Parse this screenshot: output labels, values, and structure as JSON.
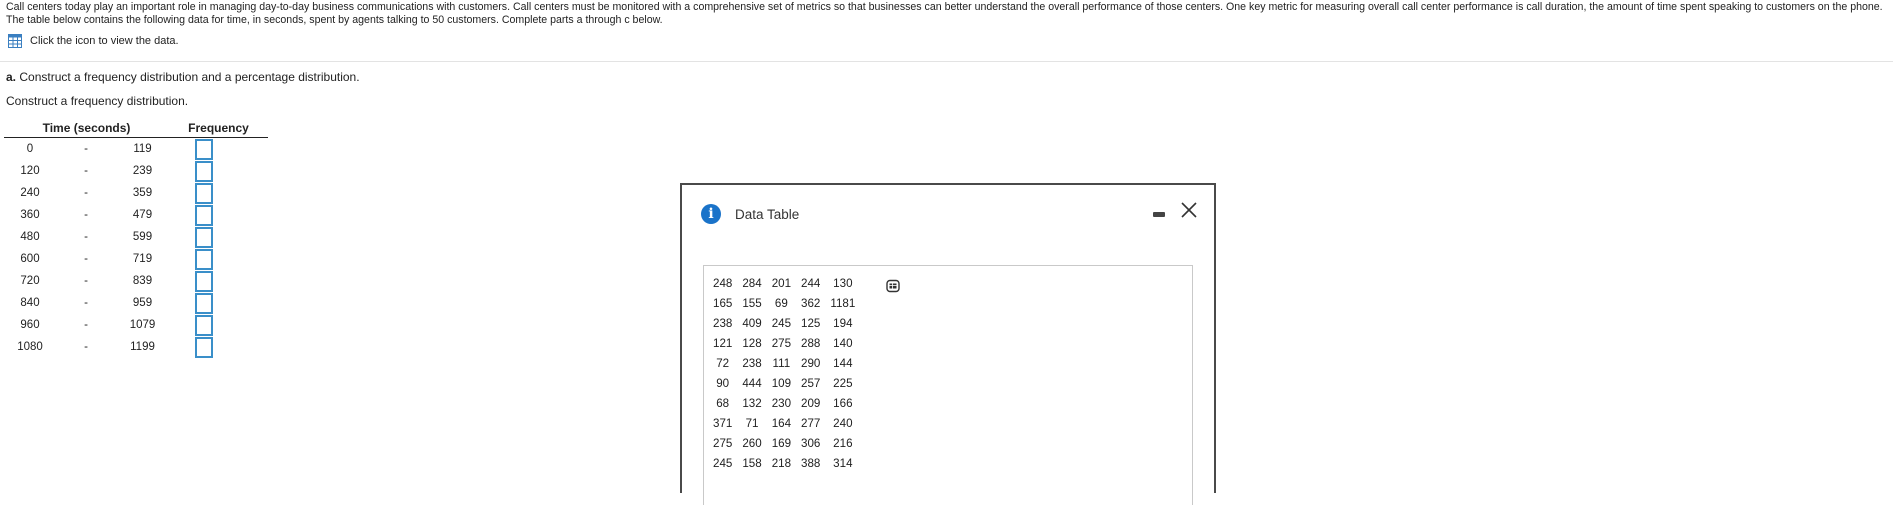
{
  "problem": {
    "text": "Call centers today play an important role in managing day-to-day business communications with customers. Call centers must be monitored with a comprehensive set of metrics so that businesses can better understand the overall performance of those centers. One key metric for measuring overall call center performance is call duration, the amount of time spent speaking to customers on the phone. The table below contains the following data for time, in seconds, spent by agents talking to 50 customers. Complete parts a through c below.",
    "data_link_label": "Click the icon to view the data."
  },
  "part_a": {
    "label": "a.",
    "heading": "Construct a frequency distribution and a percentage distribution.",
    "instruction": "Construct a frequency distribution."
  },
  "freq_table": {
    "headers": {
      "time": "Time (seconds)",
      "frequency": "Frequency"
    },
    "separator": "-",
    "rows": [
      {
        "low": "0",
        "high": "119",
        "frequency": ""
      },
      {
        "low": "120",
        "high": "239",
        "frequency": ""
      },
      {
        "low": "240",
        "high": "359",
        "frequency": ""
      },
      {
        "low": "360",
        "high": "479",
        "frequency": ""
      },
      {
        "low": "480",
        "high": "599",
        "frequency": ""
      },
      {
        "low": "600",
        "high": "719",
        "frequency": ""
      },
      {
        "low": "720",
        "high": "839",
        "frequency": ""
      },
      {
        "low": "840",
        "high": "959",
        "frequency": ""
      },
      {
        "low": "960",
        "high": "1079",
        "frequency": ""
      },
      {
        "low": "1080",
        "high": "1199",
        "frequency": ""
      }
    ]
  },
  "dialog": {
    "title": "Data Table",
    "icons": {
      "info": "info-icon",
      "minimize": "minimize-icon",
      "close": "close-icon",
      "copy": "copy-icon"
    },
    "rows": [
      [
        "248",
        "284",
        "201",
        "244",
        "130"
      ],
      [
        "165",
        "155",
        "69",
        "362",
        "1181"
      ],
      [
        "238",
        "409",
        "245",
        "125",
        "194"
      ],
      [
        "121",
        "128",
        "275",
        "288",
        "140"
      ],
      [
        "72",
        "238",
        "111",
        "290",
        "144"
      ],
      [
        "90",
        "444",
        "109",
        "257",
        "225"
      ],
      [
        "68",
        "132",
        "230",
        "209",
        "166"
      ],
      [
        "371",
        "71",
        "164",
        "277",
        "240"
      ],
      [
        "275",
        "260",
        "169",
        "306",
        "216"
      ],
      [
        "245",
        "158",
        "218",
        "388",
        "314"
      ]
    ]
  },
  "colors": {
    "input_border": "#3a8fc9",
    "info_icon": "#1a73c9",
    "table_icon": "#3a7fc1"
  }
}
